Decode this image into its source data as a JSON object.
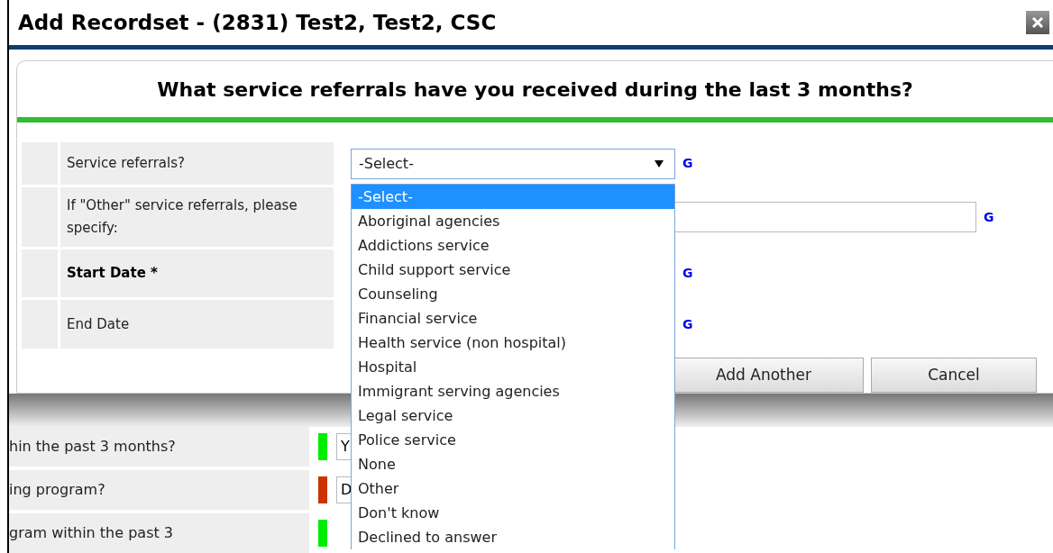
{
  "window": {
    "title": "Add Recordset - (2831) Test2, Test2, CSC"
  },
  "question": "What service referrals have you received during the last 3 months?",
  "fields": [
    {
      "label": "Service referrals?",
      "bold": false,
      "kind": "select",
      "value": "-Select-",
      "link": "G"
    },
    {
      "label": "If \"Other\" service referrals, please specify:",
      "bold": false,
      "kind": "text",
      "link": "G"
    },
    {
      "label": "Start Date *",
      "bold": true,
      "kind": "covered",
      "link": "G"
    },
    {
      "label": "End Date",
      "bold": false,
      "kind": "covered",
      "link": "G"
    }
  ],
  "dropdown": [
    {
      "label": "-Select-",
      "selected": true
    },
    {
      "label": "Aboriginal agencies",
      "selected": false
    },
    {
      "label": "Addictions service",
      "selected": false
    },
    {
      "label": "Child support service",
      "selected": false
    },
    {
      "label": "Counseling",
      "selected": false
    },
    {
      "label": "Financial service",
      "selected": false
    },
    {
      "label": "Health service (non hospital)",
      "selected": false
    },
    {
      "label": "Hospital",
      "selected": false
    },
    {
      "label": "Immigrant serving agencies",
      "selected": false
    },
    {
      "label": "Legal service",
      "selected": false
    },
    {
      "label": "Police service",
      "selected": false
    },
    {
      "label": "None",
      "selected": false
    },
    {
      "label": "Other",
      "selected": false
    },
    {
      "label": "Don't know",
      "selected": false
    },
    {
      "label": "Declined to answer",
      "selected": false
    }
  ],
  "buttons": [
    "Add Another",
    "Cancel"
  ],
  "background_rows": [
    {
      "label": "hin the past 3 months?",
      "color": "#00ee00",
      "value": "Y"
    },
    {
      "label": "ing program?",
      "color": "#cc3300",
      "value": "D"
    },
    {
      "label": "gram within the past 3",
      "color": "#00ee00"
    }
  ]
}
